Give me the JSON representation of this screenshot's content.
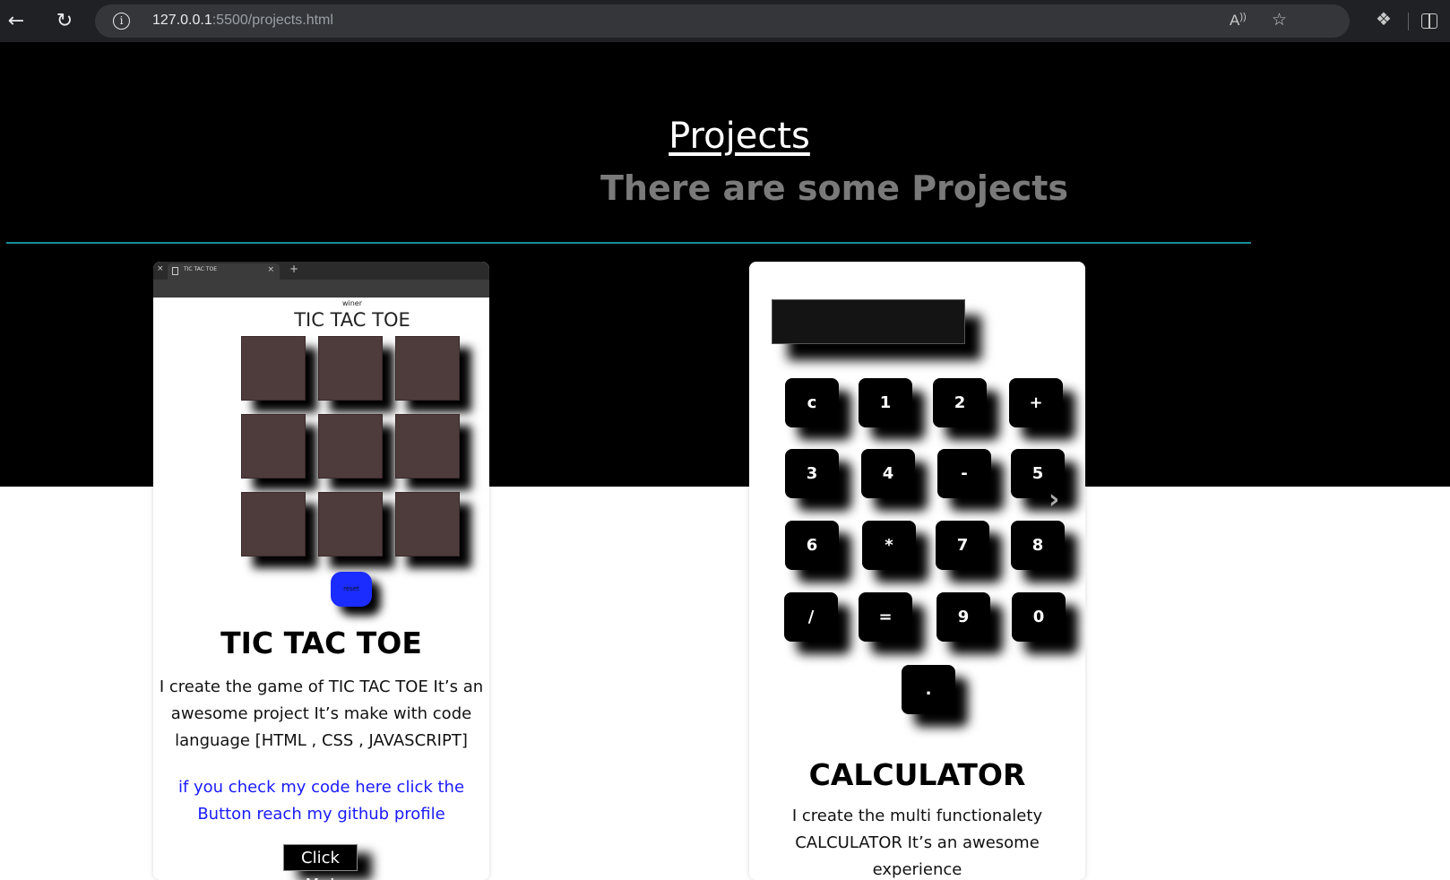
{
  "browser": {
    "url_host": "127.0.0.1",
    "url_rest": ":5500/projects.html"
  },
  "header": {
    "title": "Projects",
    "subtitle": "There are some Projects"
  },
  "tictactoe": {
    "preview": {
      "tab_title": "TIC TAC TOE",
      "winner_label": "winer",
      "game_title": "TIC TAC TOE",
      "reset_label": "reset"
    },
    "title": "TIC TAC TOE",
    "description": "I create the game of TIC TAC TOE It’s an awesome project It’s make with code language [HTML , CSS , JAVASCRIPT]",
    "link_text": "if you check my code here click the Button reach my github profile",
    "button_label": "Click Me!"
  },
  "calculator": {
    "keys": [
      "c",
      "1",
      "2",
      "+",
      "3",
      "4",
      "-",
      "5",
      "6",
      "*",
      "7",
      "8",
      "/",
      "=",
      "9",
      "0",
      "."
    ],
    "title": "CALCULATOR",
    "description": "I create the multi functionalety CALCULATOR It’s an awesome experience"
  },
  "colors": {
    "hero_bg": "#000000",
    "divider": "#1a8d9a",
    "link": "#1a1aff",
    "reset_button": "#1a2cff",
    "cell": "#4e3b3b"
  }
}
